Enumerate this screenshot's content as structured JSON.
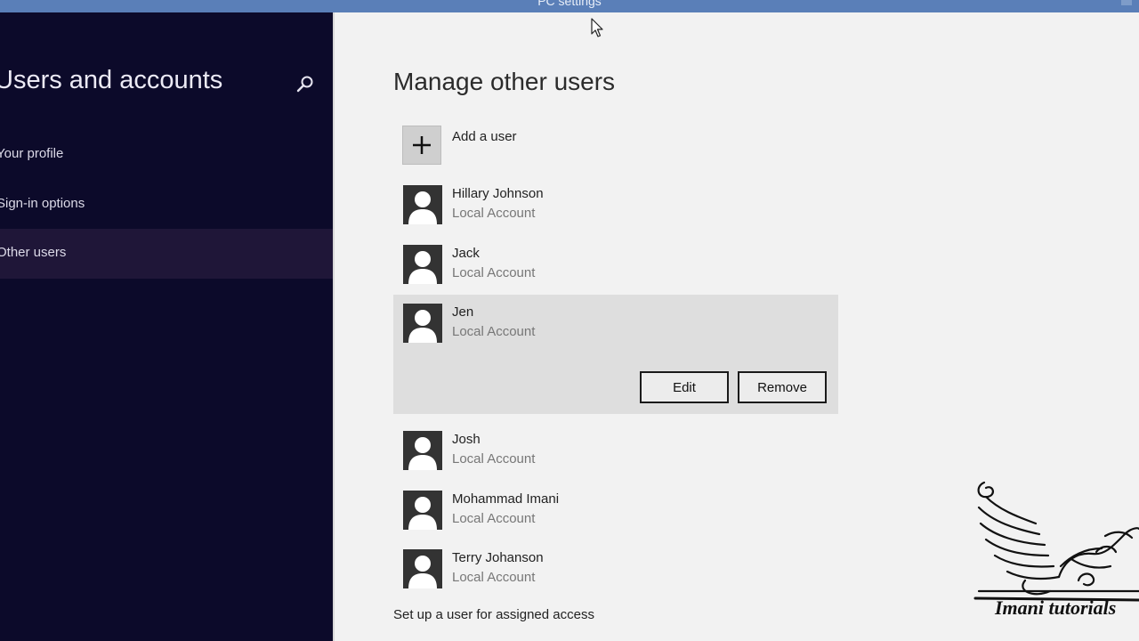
{
  "window": {
    "title": "PC settings"
  },
  "sidebar": {
    "title": "Users and accounts",
    "search_icon": "search-icon",
    "items": [
      {
        "label": "Your profile",
        "selected": false
      },
      {
        "label": "Sign-in options",
        "selected": false
      },
      {
        "label": "Other users",
        "selected": true
      }
    ]
  },
  "main": {
    "title": "Manage other users",
    "add_user": {
      "label": "Add a user",
      "icon": "plus-icon"
    },
    "users": [
      {
        "name": "Hillary Johnson",
        "type": "Local Account"
      },
      {
        "name": "Jack",
        "type": "Local Account"
      },
      {
        "name": "Jen",
        "type": "Local Account",
        "selected": true
      },
      {
        "name": "Josh",
        "type": "Local Account"
      },
      {
        "name": "Mohammad Imani",
        "type": "Local Account"
      },
      {
        "name": "Terry Johanson",
        "type": "Local Account"
      }
    ],
    "selected_actions": {
      "edit_label": "Edit",
      "remove_label": "Remove"
    },
    "assigned_access_label": "Set up a user for assigned access"
  },
  "watermark": {
    "text": "Imani tutorials"
  },
  "colors": {
    "sidebar_bg": "#0c0a2a",
    "sidebar_selected": "#1f1638",
    "main_bg": "#f2f2f2",
    "titlebar": "#5a7fb8",
    "selected_row": "#dedede"
  }
}
